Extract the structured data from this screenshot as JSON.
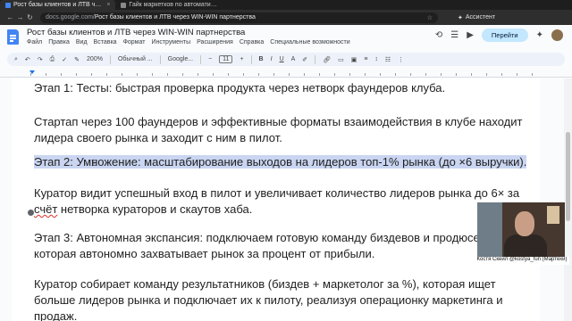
{
  "browser": {
    "tabs": [
      {
        "label": "Рост базы клиентов и ЛТВ ч…",
        "active": true
      },
      {
        "label": "Гайк маркетков по автомати…",
        "active": false
      }
    ],
    "url_host": "docs.google.com",
    "url_sep": " / ",
    "url_path": "Рост базы клиентов и ЛТВ через WIN-WIN партнерства",
    "assistant_label": "Ассистент"
  },
  "doc": {
    "title": "Рост базы клиентов и ЛТВ через WIN-WIN партнерства",
    "menus": [
      "Файл",
      "Правка",
      "Вид",
      "Вставка",
      "Формат",
      "Инструменты",
      "Расширения",
      "Справка",
      "Специальные возможности"
    ],
    "share_label": "Перейти",
    "toolbar": {
      "zoom": "200%",
      "style": "Обычный ...",
      "font": "Google...",
      "font_size": "11"
    },
    "paragraphs": {
      "p1": "Этап 1: Тесты: быстрая проверка продукта через нетворк фаундеров клуба.",
      "p2": "Стартап через 100 фаундеров и эффективные форматы взаимодействия в клубе находит лидера своего рынка и заходит с ним в пилот.",
      "p3": "Этап 2: Умножение: масштабирование выходов на лидеров топ-1% рынка (до ×6 выручки).",
      "p4_a": "Куратор видит успешный вход в пилот и увеличивает количество лидеров рынка до 6× за ",
      "p4_b": "счёт",
      "p4_c": " нетворка кураторов и скаутов хаба.",
      "p5": "Этап 3: Автономная экспансия: подключаем готовую команду биздевов и продюсера, которая автономно захватывает рынок за процент от прибыли.",
      "p6": "Куратор собирает команду результатников (биздев + маркетолог за %), которая ищет больше лидеров рынка и подключает их к пилоту, реализуя операционку маркетинга и продаж."
    }
  },
  "video": {
    "caption": "Костя Скейл @kostya_fun (Мартехи)"
  },
  "colors": {
    "selection": "#c9d5f1",
    "share_button": "#c2e7ff",
    "docs_blue": "#4285f4"
  }
}
